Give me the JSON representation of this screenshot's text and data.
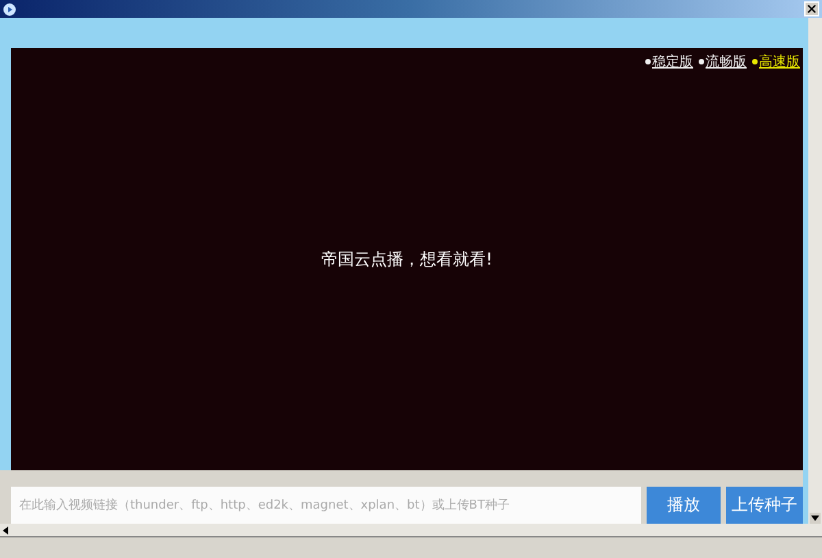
{
  "versions": [
    {
      "label": "稳定版",
      "selected": false
    },
    {
      "label": "流畅版",
      "selected": false
    },
    {
      "label": "高速版",
      "selected": true
    }
  ],
  "player": {
    "message": "帝国云点播，想看就看!"
  },
  "url_input": {
    "placeholder": "在此输入视频链接（thunder、ftp、http、ed2k、magnet、xplan、bt）或上传BT种子"
  },
  "buttons": [
    "播放",
    "上传种子"
  ]
}
